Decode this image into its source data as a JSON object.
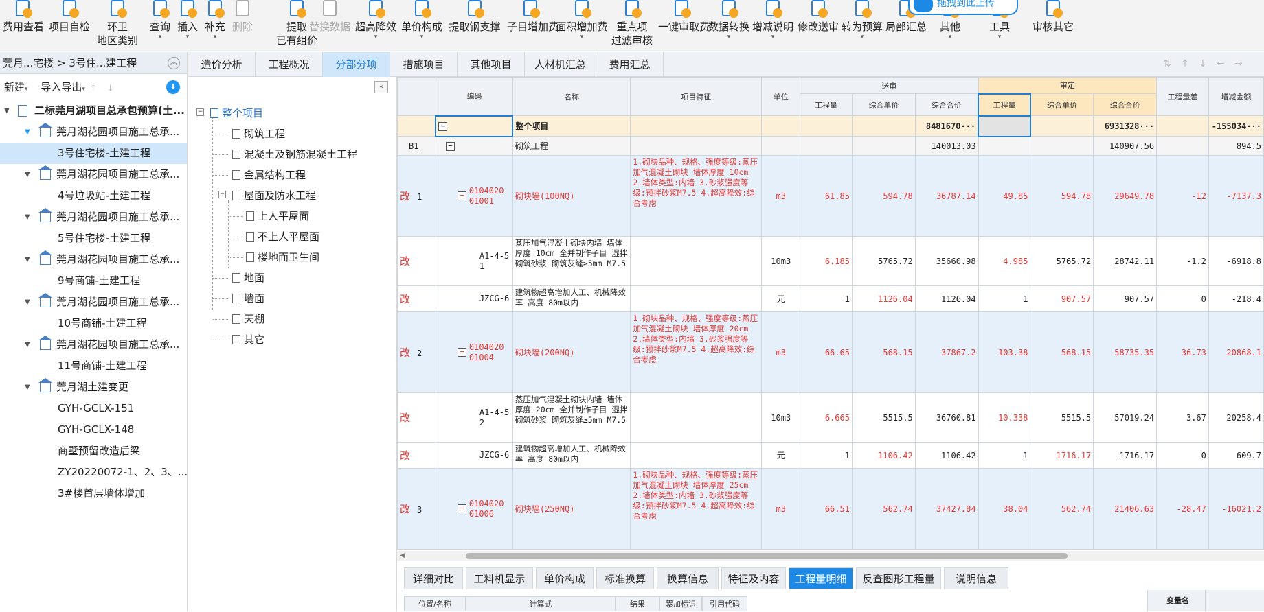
{
  "toolbar": {
    "items": [
      {
        "l1": "费用查看",
        "l2": "",
        "dd": false
      },
      {
        "l1": "项目自检",
        "l2": "",
        "dd": false
      },
      {
        "l1": "环卫",
        "l2": "地区类别",
        "dd": false
      },
      {
        "l1": "查询",
        "l2": "",
        "dd": true
      },
      {
        "l1": "插入",
        "l2": "",
        "dd": true
      },
      {
        "l1": "补充",
        "l2": "",
        "dd": true
      },
      {
        "l1": "删除",
        "l2": "",
        "dd": false,
        "disabled": true
      },
      {
        "l1": "提取",
        "l2": "已有组价",
        "dd": false
      },
      {
        "l1": "替换数据",
        "l2": "",
        "dd": false,
        "disabled": true
      },
      {
        "l1": "超高降效",
        "l2": "",
        "dd": true
      },
      {
        "l1": "单价构成",
        "l2": "",
        "dd": true
      },
      {
        "l1": "提取钢支撑",
        "l2": "",
        "dd": false
      },
      {
        "l1": "子目增加费",
        "l2": "",
        "dd": false
      },
      {
        "l1": "面积增加费",
        "l2": "",
        "dd": true
      },
      {
        "l1": "重点项",
        "l2": "过滤审核",
        "dd": false
      },
      {
        "l1": "一键审取费",
        "l2": "",
        "dd": false
      },
      {
        "l1": "数据转换",
        "l2": "",
        "dd": true
      },
      {
        "l1": "增减说明",
        "l2": "",
        "dd": true
      },
      {
        "l1": "修改送审",
        "l2": "",
        "dd": false
      },
      {
        "l1": "转为预算",
        "l2": "",
        "dd": true
      },
      {
        "l1": "局部汇总",
        "l2": "",
        "dd": false
      },
      {
        "l1": "其他",
        "l2": "",
        "dd": true
      },
      {
        "l1": "工具",
        "l2": "",
        "dd": true
      },
      {
        "l1": "审核其它",
        "l2": "",
        "dd": false
      }
    ],
    "popup_text": "拖拽到此上传"
  },
  "left": {
    "breadcrumb": "莞月...宅楼 > 3号住...建工程",
    "new_label": "新建",
    "import_export_label": "导入导出",
    "tree": [
      {
        "label": "二标莞月湖项目总承包预算(土...",
        "level": 0,
        "icon": "building",
        "bold": true
      },
      {
        "label": "莞月湖花园项目施工总承...",
        "level": 1,
        "icon": "home",
        "blue_tri": true
      },
      {
        "label": "3号住宅楼-土建工程",
        "level": 2,
        "selected": true
      },
      {
        "label": "莞月湖花园项目施工总承...",
        "level": 1,
        "icon": "home"
      },
      {
        "label": "4号垃圾站-土建工程",
        "level": 2
      },
      {
        "label": "莞月湖花园项目施工总承...",
        "level": 1,
        "icon": "home"
      },
      {
        "label": "5号住宅楼-土建工程",
        "level": 2
      },
      {
        "label": "莞月湖花园项目施工总承...",
        "level": 1,
        "icon": "home"
      },
      {
        "label": "9号商铺-土建工程",
        "level": 2
      },
      {
        "label": "莞月湖花园项目施工总承...",
        "level": 1,
        "icon": "home"
      },
      {
        "label": "10号商铺-土建工程",
        "level": 2
      },
      {
        "label": "莞月湖花园项目施工总承...",
        "level": 1,
        "icon": "home"
      },
      {
        "label": "11号商铺-土建工程",
        "level": 2
      },
      {
        "label": "莞月湖土建变更",
        "level": 1,
        "icon": "home"
      },
      {
        "label": "GYH-GCLX-151",
        "level": 2
      },
      {
        "label": "GYH-GCLX-148",
        "level": 2
      },
      {
        "label": "商墅预留改造后梁",
        "level": 2
      },
      {
        "label": "ZY20220072-1、2、3、...",
        "level": 2
      },
      {
        "label": "3#楼首层墙体增加",
        "level": 2
      }
    ]
  },
  "mid": {
    "root": "整个项目",
    "items": [
      {
        "label": "砌筑工程",
        "level": 1
      },
      {
        "label": "混凝土及钢筋混凝土工程",
        "level": 1
      },
      {
        "label": "金属结构工程",
        "level": 1
      },
      {
        "label": "屋面及防水工程",
        "level": 1,
        "expand": true
      },
      {
        "label": "上人平屋面",
        "level": 2
      },
      {
        "label": "不上人平屋面",
        "level": 2
      },
      {
        "label": "楼地面卫生间",
        "level": 2
      },
      {
        "label": "地面",
        "level": 1
      },
      {
        "label": "墙面",
        "level": 1
      },
      {
        "label": "天棚",
        "level": 1
      },
      {
        "label": "其它",
        "level": 1
      }
    ]
  },
  "tabs": [
    "造价分析",
    "工程概况",
    "分部分项",
    "措施项目",
    "其他项目",
    "人材机汇总",
    "费用汇总"
  ],
  "grid": {
    "headers": {
      "code": "编码",
      "name": "名称",
      "feature": "项目特征",
      "unit": "单位",
      "songshen": "送审",
      "shending": "审定",
      "qty": "工程量",
      "uprice": "综合单价",
      "total": "综合合价",
      "qtydiff": "工程量差",
      "incdec": "增减金额"
    },
    "whole": {
      "name": "整个项目",
      "s_total": "8481670···",
      "d_total": "6931328···",
      "diff": "-155034···"
    },
    "b1": {
      "num": "B1",
      "name": "砌筑工程",
      "s_total": "140013.03",
      "d_total": "140907.56",
      "diff": "894.5"
    },
    "rows": [
      {
        "type": "item",
        "mark": "改",
        "num": "1",
        "code": "0104020\n01001",
        "name": "砌块墙(100NQ)",
        "feature": "1.砌块品种、规格、强度等级:蒸压加气混凝土砌块 墙体厚度 10cm\n2.墙体类型:内墙\n3.砂浆强度等级:预拌砂浆M7.5\n4.超高降效:综合考虑",
        "unit": "m3",
        "s_qty": "61.85",
        "s_up": "594.78",
        "s_total": "36787.14",
        "d_qty": "49.85",
        "d_up": "594.78",
        "d_total": "29649.78",
        "qdiff": "-12",
        "inc": "-7137.3"
      },
      {
        "type": "child",
        "mark": "改",
        "code": "A1-4-5\n1",
        "name": "蒸压加气混凝土砌块内墙 墙体厚度 10cm 全并制作子目 湿拌砌筑砂浆 砌筑灰缝≥5mm M7.5",
        "unit": "10m3",
        "s_qty": "6.185",
        "s_up": "5765.72",
        "s_total": "35660.98",
        "d_qty": "4.985",
        "d_up": "5765.72",
        "d_total": "28742.11",
        "qdiff": "-1.2",
        "inc": "-6918.8"
      },
      {
        "type": "child2",
        "mark": "改",
        "code": "JZCG-6",
        "name": "建筑物超高增加人工、机械降效率 高度 80m以内",
        "unit": "元",
        "s_qty": "1",
        "s_up": "1126.04",
        "s_total": "1126.04",
        "d_qty": "1",
        "d_up": "907.57",
        "d_total": "907.57",
        "qdiff": "0",
        "inc": "-218.4"
      },
      {
        "type": "item",
        "mark": "改",
        "num": "2",
        "code": "0104020\n01004",
        "name": "砌块墙(200NQ)",
        "feature": "1.砌块品种、规格、强度等级:蒸压加气混凝土砌块 墙体厚度 20cm\n2.墙体类型:内墙\n3.砂浆强度等级:预拌砂浆M7.5\n4.超高降效:综合考虑",
        "unit": "m3",
        "s_qty": "66.65",
        "s_up": "568.15",
        "s_total": "37867.2",
        "d_qty": "103.38",
        "d_up": "568.15",
        "d_total": "58735.35",
        "qdiff": "36.73",
        "inc": "20868.1"
      },
      {
        "type": "child",
        "mark": "改",
        "code": "A1-4-5\n2",
        "name": "蒸压加气混凝土砌块内墙 墙体厚度 20cm 全并制作子目 湿拌砌筑砂浆 砌筑灰缝≥5mm M7.5",
        "unit": "10m3",
        "s_qty": "6.665",
        "s_up": "5515.5",
        "s_total": "36760.81",
        "d_qty": "10.338",
        "d_up": "5515.5",
        "d_total": "57019.24",
        "qdiff": "3.67",
        "inc": "20258.4"
      },
      {
        "type": "child2",
        "mark": "改",
        "code": "JZCG-6",
        "name": "建筑物超高增加人工、机械降效率 高度 80m以内",
        "unit": "元",
        "s_qty": "1",
        "s_up": "1106.42",
        "s_total": "1106.42",
        "d_qty": "1",
        "d_up": "1716.17",
        "d_total": "1716.17",
        "qdiff": "0",
        "inc": "609.7"
      },
      {
        "type": "item",
        "mark": "改",
        "num": "3",
        "code": "0104020\n01006",
        "name": "砌块墙(250NQ)",
        "feature": "1.砌块品种、规格、强度等级:蒸压加气混凝土砌块 墙体厚度 25cm\n2.墙体类型:内墙\n3.砂浆强度等级:预拌砂浆M7.5\n4.超高降效:综合考虑",
        "unit": "m3",
        "s_qty": "66.51",
        "s_up": "562.74",
        "s_total": "37427.84",
        "d_qty": "38.04",
        "d_up": "562.74",
        "d_total": "21406.63",
        "qdiff": "-28.47",
        "inc": "-16021.2"
      }
    ]
  },
  "bottom_tabs": [
    "详细对比",
    "工料机显示",
    "单价构成",
    "标准换算",
    "换算信息",
    "特征及内容",
    "工程量明细",
    "反查图形工程量",
    "说明信息"
  ],
  "bottom_headers": [
    "位置/名称",
    "计算式",
    "结果",
    "累加标识",
    "引用代码"
  ],
  "bottom_right_header": "变量名",
  "colors": {
    "accent": "#1e88e5",
    "red": "#e53935",
    "selected_bg": "#cfe6fb"
  }
}
